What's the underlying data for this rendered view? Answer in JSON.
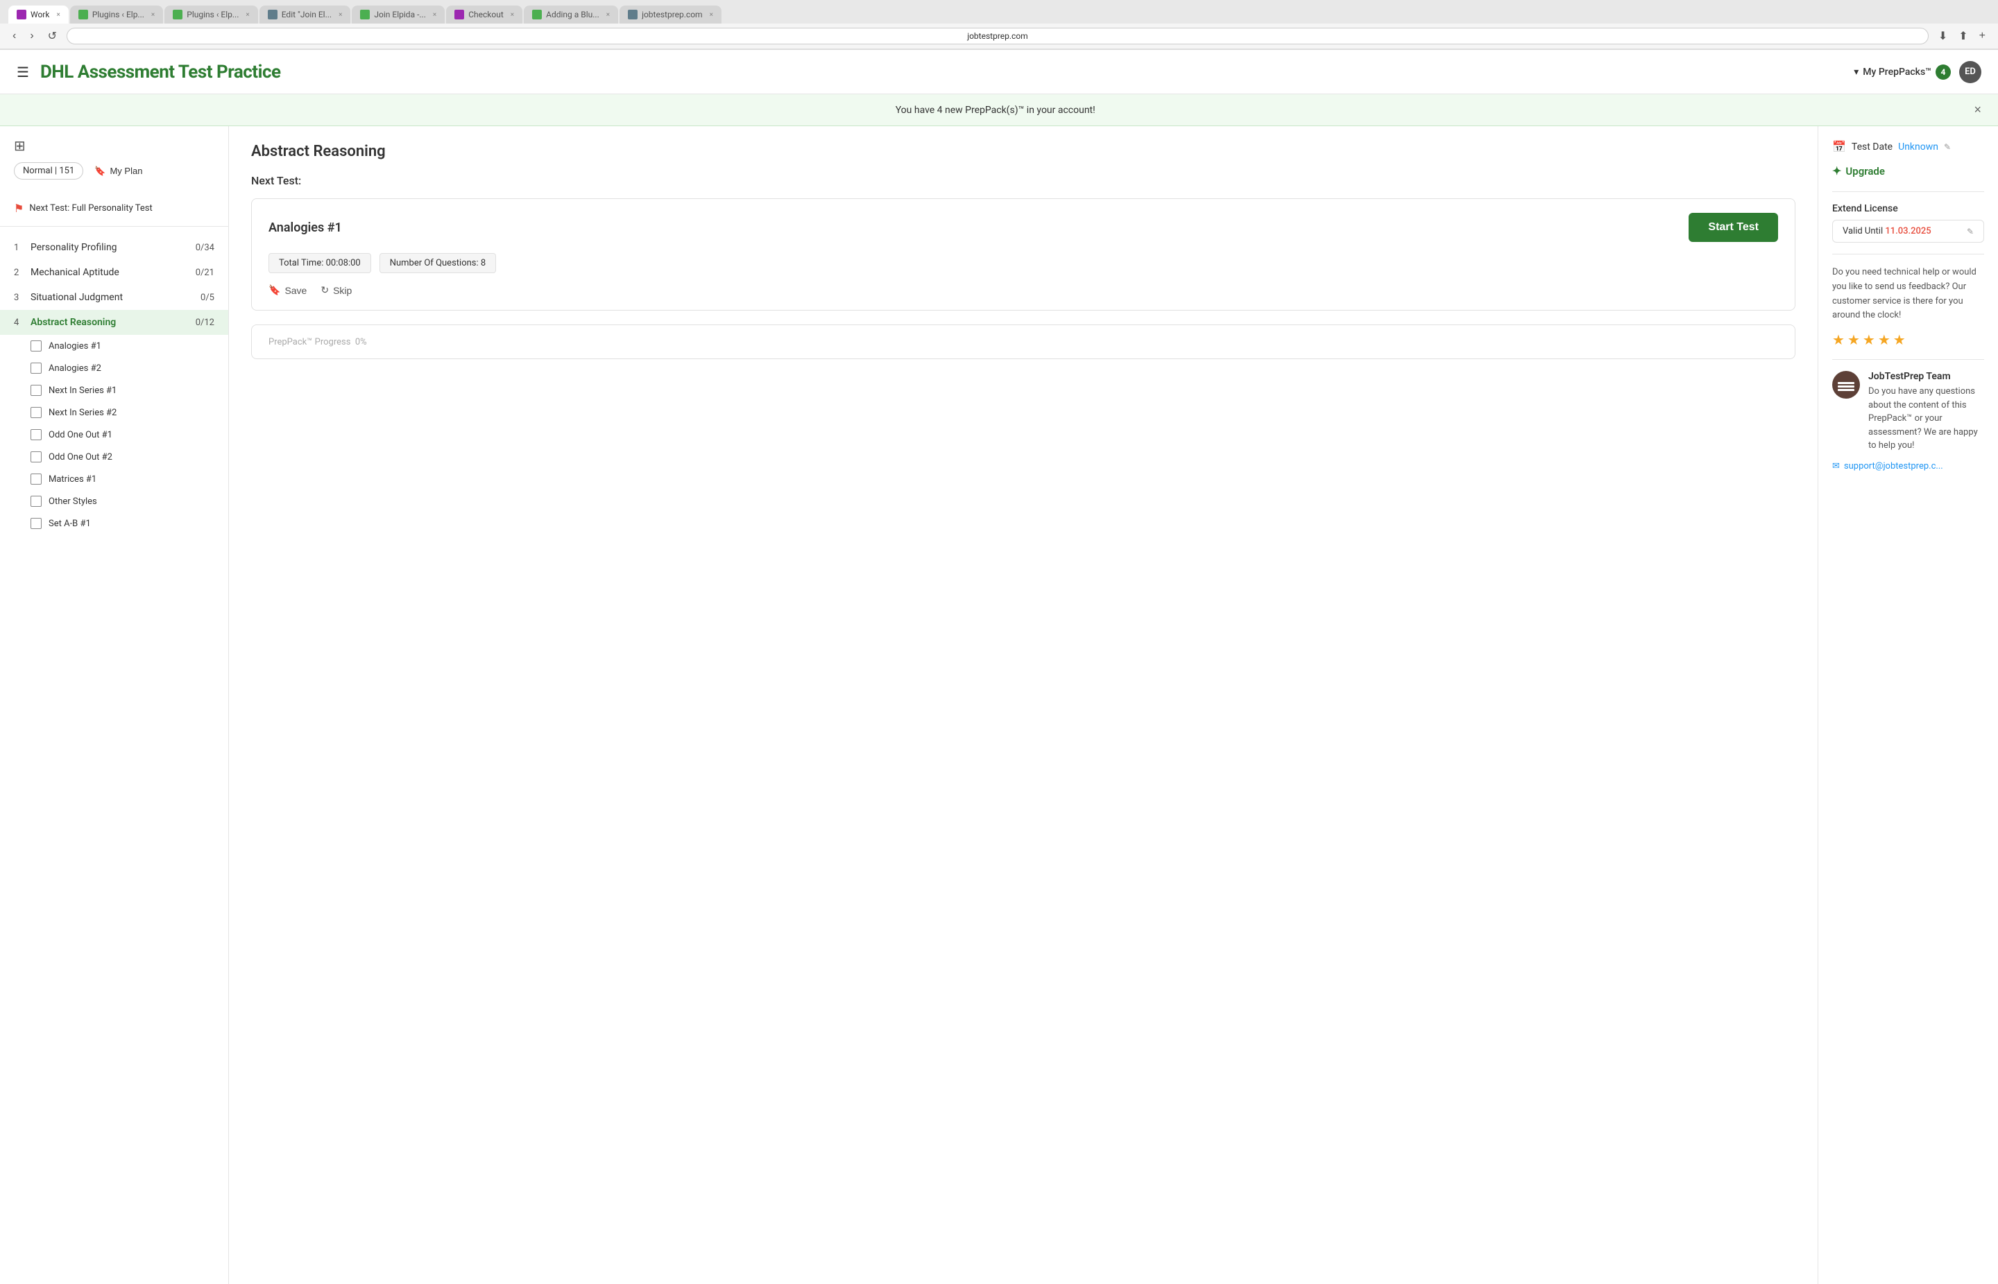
{
  "browser": {
    "tabs": [
      {
        "id": "work",
        "label": "Work",
        "active": true,
        "favicon_color": "#9c27b0"
      },
      {
        "id": "plugins1",
        "label": "Plugins ‹ Elp...",
        "active": false,
        "favicon_color": "#4caf50"
      },
      {
        "id": "plugins2",
        "label": "Plugins ‹ Elp...",
        "active": false,
        "favicon_color": "#4caf50"
      },
      {
        "id": "edit",
        "label": "Edit \"Join El...",
        "active": false,
        "favicon_color": "#607d8b"
      },
      {
        "id": "join",
        "label": "Join Elpida -...",
        "active": false,
        "favicon_color": "#4caf50"
      },
      {
        "id": "checkout",
        "label": "Checkout",
        "active": false,
        "favicon_color": "#9c27b0"
      },
      {
        "id": "adding",
        "label": "Adding a Blu...",
        "active": false,
        "favicon_color": "#4caf50"
      },
      {
        "id": "jobtest",
        "label": "jobtestprep.com",
        "active": false,
        "favicon_color": "#607d8b"
      }
    ],
    "address": "jobtestprep.com"
  },
  "header": {
    "menu_icon": "☰",
    "title": "DHL Assessment Test Practice",
    "preppack_label": "My PrepPacks™",
    "preppack_count": "4",
    "avatar_initials": "ED"
  },
  "banner": {
    "message": "You have 4 new PrepPack(s)™ in your account!",
    "close_icon": "×"
  },
  "sidebar": {
    "grid_icon": "⊞",
    "filter_badge": "Normal | 151",
    "my_plan_label": "My Plan",
    "next_test_label": "Next Test: Full Personality Test",
    "items": [
      {
        "num": "1",
        "label": "Personality Profiling",
        "score": "0/34",
        "active": false
      },
      {
        "num": "2",
        "label": "Mechanical Aptitude",
        "score": "0/21",
        "active": false
      },
      {
        "num": "3",
        "label": "Situational Judgment",
        "score": "0/5",
        "active": false
      },
      {
        "num": "4",
        "label": "Abstract Reasoning",
        "score": "0/12",
        "active": true
      }
    ],
    "sub_items": [
      {
        "label": "Analogies #1",
        "active": true
      },
      {
        "label": "Analogies #2",
        "active": false
      },
      {
        "label": "Next In Series #1",
        "active": false
      },
      {
        "label": "Next In Series #2",
        "active": false
      },
      {
        "label": "Odd One Out #1",
        "active": false
      },
      {
        "label": "Odd One Out #2",
        "active": false
      },
      {
        "label": "Matrices #1",
        "active": false
      },
      {
        "label": "Other Styles",
        "active": false
      },
      {
        "label": "Set A-B #1",
        "active": false
      }
    ]
  },
  "content": {
    "title": "Abstract Reasoning",
    "next_test_prefix": "Next Test:",
    "test_card": {
      "name": "Analogies #1",
      "start_button": "Start Test",
      "total_time_label": "Total Time: 00:08:00",
      "questions_label": "Number Of Questions: 8",
      "save_label": "Save",
      "skip_label": "Skip"
    },
    "progress": {
      "label": "PrepPack™ Progress",
      "value": "0%"
    }
  },
  "right_panel": {
    "test_date_label": "Test Date",
    "test_date_value": "Unknown",
    "edit_icon": "✎",
    "upgrade_label": "Upgrade",
    "extend_license_label": "Extend License",
    "valid_until_label": "Valid Until",
    "valid_until_date": "11.03.2025",
    "support_text": "Do you need technical help or would you like to send us feedback? Our customer service is there for you around the clock!",
    "stars": [
      "★",
      "★",
      "★",
      "★",
      "★"
    ],
    "team_name": "JobTestPrep Team",
    "team_text": "Do you have any questions about the content of this PrepPack™ or your assessment? We are happy to help you!",
    "support_link": "support@jobtestprep.c..."
  }
}
